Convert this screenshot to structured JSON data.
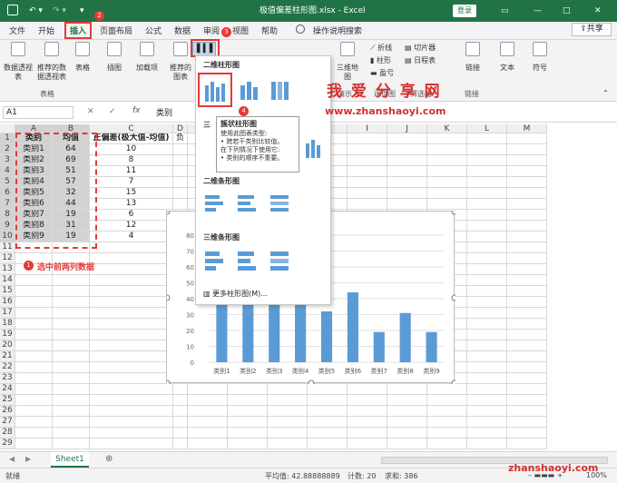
{
  "title": {
    "filename": "极值偏差柱形图.xlsx - Excel",
    "login": "登录"
  },
  "ribbon_tabs": [
    "文件",
    "开始",
    "插入",
    "页面布局",
    "公式",
    "数据",
    "审阅",
    "视图",
    "帮助",
    "操作说明搜索"
  ],
  "share": "共享",
  "ribbon": {
    "pivot": "数据透视表",
    "rec_pivot": "推荐的数据透视表",
    "table": "表格",
    "group_table": "表格",
    "illus": "插图",
    "addins": "加载项",
    "rec_chart": "推荐的图表",
    "map3d": "三维地图",
    "tour": "演示",
    "line": "折线",
    "column": "柱形",
    "winloss": "盈亏",
    "sparkline": "迷你图",
    "slicer": "切片器",
    "timeline": "日程表",
    "filter": "筛选器",
    "link": "链接",
    "group_link": "链接",
    "text": "文本",
    "symbol": "符号"
  },
  "formula": {
    "namebox": "A1",
    "fx": "fx",
    "value": "类别"
  },
  "columns": [
    "A",
    "B",
    "C",
    "D",
    "E",
    "F",
    "G",
    "H",
    "I",
    "J",
    "K",
    "L",
    "M"
  ],
  "table": {
    "headers": [
      "类别",
      "均值",
      "正偏差(极大值-均值)",
      "负"
    ],
    "rows": [
      [
        "类别1",
        "64",
        "10"
      ],
      [
        "类别2",
        "69",
        "8"
      ],
      [
        "类别3",
        "51",
        "11"
      ],
      [
        "类别4",
        "57",
        "7"
      ],
      [
        "类别5",
        "32",
        "15"
      ],
      [
        "类别6",
        "44",
        "13"
      ],
      [
        "类别7",
        "19",
        "6"
      ],
      [
        "类别8",
        "31",
        "12"
      ],
      [
        "类别9",
        "19",
        "4"
      ]
    ]
  },
  "dropdown": {
    "h2d": "二维柱形图",
    "h3d_short": "三",
    "h2bar": "二维条形图",
    "h3bar": "三维条形图",
    "more": "更多柱形图(M)..."
  },
  "tooltip": {
    "title": "簇状柱形图",
    "l1": "使用此图表类型:",
    "l2": "• 跨若干类别比较值。",
    "l3": "在下列情况下使用它:",
    "l4": "• 类别的顺序不重要。"
  },
  "annotations": {
    "b1": "1",
    "b2": "2",
    "b3": "3",
    "b4": "4",
    "select_note": "选中前两列数据"
  },
  "watermark": {
    "cn": "我 爱 分 享 网",
    "url": "www.zhanshaoyi.com",
    "url_bottom": "zhanshaoyi.com"
  },
  "sheet": {
    "tab": "Sheet1"
  },
  "status": {
    "ready": "就绪",
    "avg": "平均值: 42.88888889",
    "count": "计数: 20",
    "sum": "求和: 386",
    "zoom": "100%"
  },
  "chart_data": {
    "type": "bar",
    "categories": [
      "类别1",
      "类别2",
      "类别3",
      "类别4",
      "类别5",
      "类别6",
      "类别7",
      "类别8",
      "类别9"
    ],
    "values": [
      64,
      69,
      51,
      57,
      32,
      44,
      19,
      31,
      19
    ],
    "ylim": [
      0,
      80
    ],
    "yticks": [
      "80",
      "70",
      "60",
      "50",
      "40",
      "30",
      "20",
      "10",
      "0"
    ],
    "color": "#5b9bd5"
  }
}
